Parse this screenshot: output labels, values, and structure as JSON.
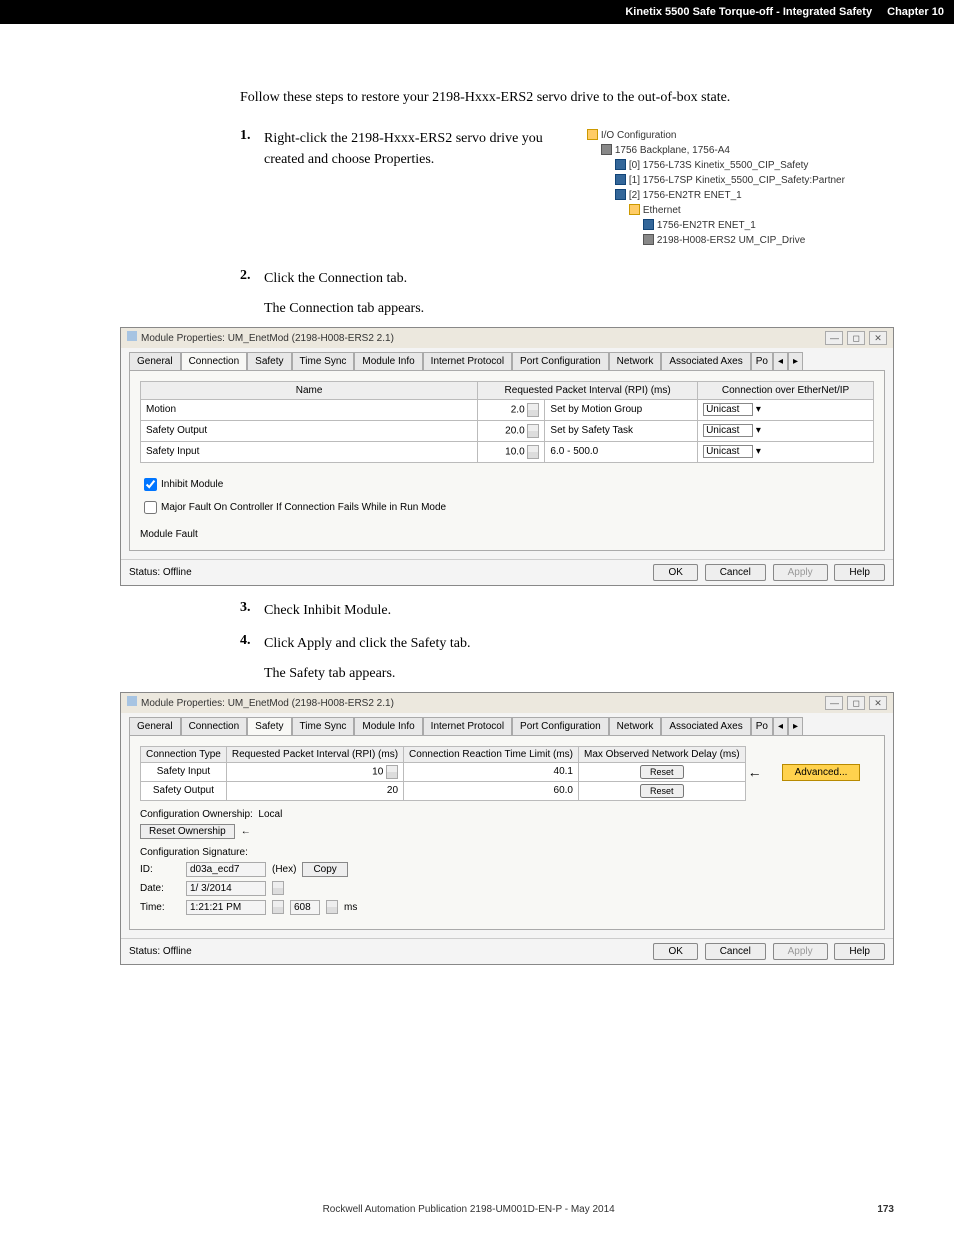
{
  "header": {
    "title": "Kinetix 5500 Safe Torque-off - Integrated Safety",
    "chapter": "Chapter 10"
  },
  "intro": "Follow these steps to restore your 2198-Hxxx-ERS2 servo drive to the out-of-box state.",
  "steps": {
    "s1": {
      "num": "1.",
      "text": "Right-click the 2198-Hxxx-ERS2 servo drive you created and choose Properties."
    },
    "s2": {
      "num": "2.",
      "text": "Click the Connection tab.",
      "sub": "The Connection tab appears."
    },
    "s3": {
      "num": "3.",
      "text": "Check Inhibit Module."
    },
    "s4": {
      "num": "4.",
      "text": "Click Apply and click the Safety tab.",
      "sub": "The Safety tab appears."
    }
  },
  "tree": {
    "root": "I/O Configuration",
    "bp": "1756 Backplane, 1756-A4",
    "n0": "[0] 1756-L73S Kinetix_5500_CIP_Safety",
    "n1": "[1] 1756-L7SP Kinetix_5500_CIP_Safety:Partner",
    "n2": "[2] 1756-EN2TR ENET_1",
    "eth": "Ethernet",
    "e1": "1756-EN2TR ENET_1",
    "e2": "2198-H008-ERS2 UM_CIP_Drive"
  },
  "dlg1": {
    "title": "Module Properties: UM_EnetMod (2198-H008-ERS2 2.1)",
    "tabs": [
      "General",
      "Connection",
      "Safety",
      "Time Sync",
      "Module Info",
      "Internet Protocol",
      "Port Configuration",
      "Network",
      "Associated Axes",
      "Po"
    ],
    "th": {
      "name": "Name",
      "rpi": "Requested Packet Interval (RPI) (ms)",
      "conn": "Connection over EtherNet/IP"
    },
    "rows": [
      {
        "name": "Motion",
        "rpi": "2.0",
        "note": "Set by Motion Group",
        "conn": "Unicast"
      },
      {
        "name": "Safety Output",
        "rpi": "20.0",
        "note": "Set by Safety Task",
        "conn": "Unicast"
      },
      {
        "name": "Safety Input",
        "rpi": "10.0",
        "note": "6.0 - 500.0",
        "conn": "Unicast"
      }
    ],
    "chk1": "Inhibit Module",
    "chk2": "Major Fault On Controller If Connection Fails While in Run Mode",
    "modfault": "Module Fault",
    "status": "Status: Offline",
    "btns": {
      "ok": "OK",
      "cancel": "Cancel",
      "apply": "Apply",
      "help": "Help"
    }
  },
  "dlg2": {
    "title": "Module Properties: UM_EnetMod (2198-H008-ERS2 2.1)",
    "tabs": [
      "General",
      "Connection",
      "Safety",
      "Time Sync",
      "Module Info",
      "Internet Protocol",
      "Port Configuration",
      "Network",
      "Associated Axes",
      "Po"
    ],
    "tbl": {
      "h1": "Connection Type",
      "h2": "Requested Packet Interval (RPI) (ms)",
      "h3": "Connection Reaction Time Limit (ms)",
      "h4": "Max Observed Network Delay (ms)",
      "r1": {
        "c1": "Safety Input",
        "c2": "10",
        "c3": "40.1",
        "c4": "Reset"
      },
      "r2": {
        "c1": "Safety Output",
        "c2": "20",
        "c3": "60.0",
        "c4": "Reset"
      }
    },
    "adv": "Advanced...",
    "own_label": "Configuration Ownership:",
    "own_val": "Local",
    "reset_btn": "Reset Ownership",
    "arrow": "←",
    "sig_label": "Configuration Signature:",
    "id_lbl": "ID:",
    "id_val": "d03a_ecd7",
    "hex": "(Hex)",
    "copy": "Copy",
    "date_lbl": "Date:",
    "date_val": "1/ 3/2014",
    "time_lbl": "Time:",
    "time_val": "1:21:21 PM",
    "time_ms": "608",
    "ms": "ms",
    "status": "Status: Offline",
    "btns": {
      "ok": "OK",
      "cancel": "Cancel",
      "apply": "Apply",
      "help": "Help"
    }
  },
  "footer": {
    "pub": "Rockwell Automation Publication 2198-UM001D-EN-P - May 2014",
    "page": "173"
  }
}
